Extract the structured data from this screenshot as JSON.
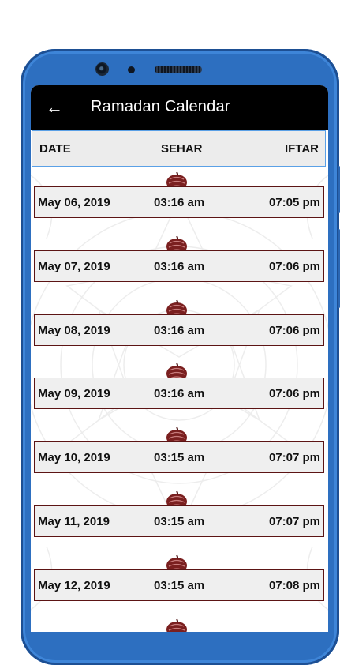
{
  "app": {
    "title": "Ramadan Calendar",
    "back_label": "←"
  },
  "table": {
    "headers": {
      "date": "DATE",
      "sehar": "SEHAR",
      "iftar": "IFTAR"
    },
    "rows": [
      {
        "date": "May 06, 2019",
        "sehar": "03:16 am",
        "iftar": "07:05 pm"
      },
      {
        "date": "May 07, 2019",
        "sehar": "03:16 am",
        "iftar": "07:06 pm"
      },
      {
        "date": "May 08, 2019",
        "sehar": "03:16 am",
        "iftar": "07:06 pm"
      },
      {
        "date": "May 09, 2019",
        "sehar": "03:16 am",
        "iftar": "07:06 pm"
      },
      {
        "date": "May 10, 2019",
        "sehar": "03:15 am",
        "iftar": "07:07 pm"
      },
      {
        "date": "May 11, 2019",
        "sehar": "03:15 am",
        "iftar": "07:07 pm"
      },
      {
        "date": "May 12, 2019",
        "sehar": "03:15 am",
        "iftar": "07:08 pm"
      }
    ]
  },
  "icons": {
    "row_icon": "date-fruit-icon"
  },
  "colors": {
    "app_bar": "#000000",
    "phone_frame": "#2d6fc0",
    "row_border": "#5c1414",
    "date_fruit": "#7a1f1f",
    "header_border": "#5aa0e6"
  }
}
